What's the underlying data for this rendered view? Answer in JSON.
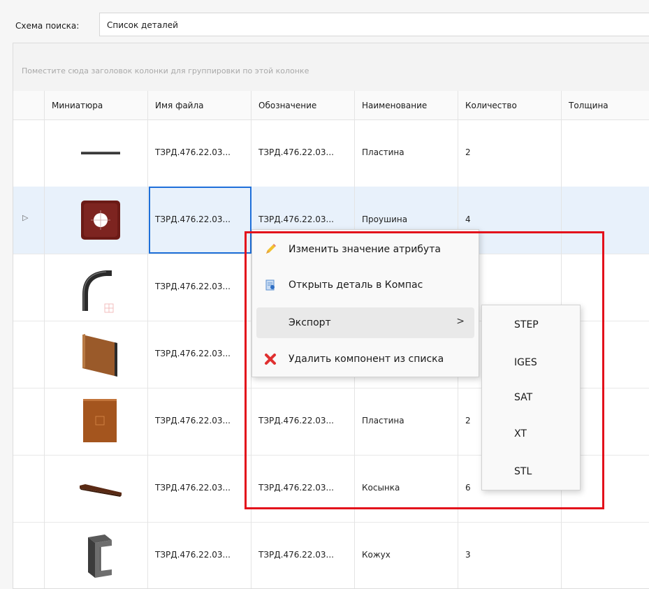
{
  "search_scheme": {
    "label": "Схема поиска:",
    "value": "Список деталей"
  },
  "grid": {
    "group_hint": "Поместите сюда заголовок колонки для группировки по этой колонке",
    "columns": [
      "Миниатюра",
      "Имя файла",
      "Обозначение",
      "Наименование",
      "Количество",
      "Толщина"
    ],
    "rows": [
      {
        "file": "ТЗРД.476.22.03...",
        "designation": "ТЗРД.476.22.03...",
        "name": "Пластина",
        "qty": "2",
        "thumb": "bar-thumbnail-icon"
      },
      {
        "file": "ТЗРД.476.22.03...",
        "designation": "ТЗРД.476.22.03...",
        "name": "Проушина",
        "qty": "4",
        "thumb": "lug-thumbnail-icon",
        "selected": true,
        "indicator": "▷"
      },
      {
        "file": "ТЗРД.476.22.03...",
        "designation": "",
        "name": "",
        "qty": "",
        "thumb": "bent-pipe-thumbnail-icon"
      },
      {
        "file": "ТЗРД.476.22.03...",
        "designation": "",
        "name": "",
        "qty": "",
        "thumb": "angled-plate-thumbnail-icon"
      },
      {
        "file": "ТЗРД.476.22.03...",
        "designation": "ТЗРД.476.22.03...",
        "name": "Пластина",
        "qty": "2",
        "thumb": "plate-thumbnail-icon"
      },
      {
        "file": "ТЗРД.476.22.03...",
        "designation": "ТЗРД.476.22.03...",
        "name": "Косынка",
        "qty": "6",
        "thumb": "gusset-thumbnail-icon"
      },
      {
        "file": "ТЗРД.476.22.03...",
        "designation": "ТЗРД.476.22.03...",
        "name": "Кожух",
        "qty": "3",
        "thumb": "casing-thumbnail-icon"
      }
    ]
  },
  "context_menu": {
    "items": [
      {
        "label": "Изменить значение атрибута",
        "icon": "pencil-icon"
      },
      {
        "label": "Открыть деталь в Компас",
        "icon": "open-document-icon"
      },
      {
        "label": "Экспорт",
        "icon": "",
        "submenu_arrow": ">"
      },
      {
        "label": "Удалить компонент из списка",
        "icon": "red-x-icon"
      }
    ]
  },
  "export_submenu": {
    "items": [
      "STEP",
      "IGES",
      "SAT",
      "XT",
      "STL"
    ]
  },
  "colors": {
    "highlight_frame": "#e3101b",
    "selection": "#e8f1fb",
    "focus": "#1e6fd9"
  }
}
